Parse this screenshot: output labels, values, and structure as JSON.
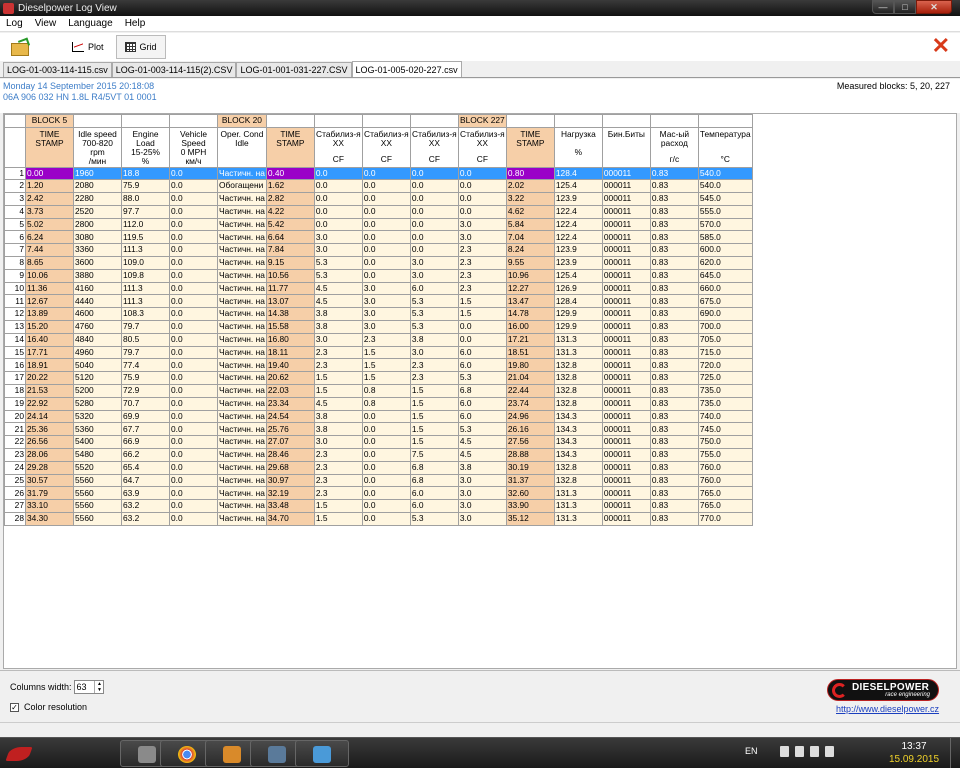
{
  "window": {
    "title": "Dieselpower Log View",
    "close": "✕",
    "max": "□",
    "min": "—"
  },
  "menu": [
    "Log",
    "View",
    "Language",
    "Help"
  ],
  "toolbar": {
    "plot_label": "Plot",
    "grid_label": "Grid"
  },
  "tabs": [
    "LOG-01-003-114-115.csv",
    "LOG-01-003-114-115(2).CSV",
    "LOG-01-001-031-227.CSV",
    "LOG-01-005-020-227.csv"
  ],
  "active_tab": 3,
  "info": {
    "date": "Monday 14 September 2015 20:18:08",
    "vehicle": "06A 906 032 HN   1.8L R4/5VT     01 0001",
    "measured_blocks": "Measured blocks: 5, 20, 227"
  },
  "blocks": [
    {
      "label": "BLOCK 5",
      "span": 4
    },
    {
      "label": "BLOCK 20",
      "span": 5
    },
    {
      "label": "BLOCK 227",
      "span": 5
    }
  ],
  "columns": [
    {
      "lines": [
        "TIME",
        "STAMP"
      ],
      "ts": true
    },
    {
      "lines": [
        "Idle speed",
        "700-820 rpm",
        "/мин"
      ]
    },
    {
      "lines": [
        "Engine Load",
        "15-25%",
        "%"
      ]
    },
    {
      "lines": [
        "Vehicle",
        "Speed",
        "0 MPH",
        "км/ч"
      ]
    },
    {
      "lines": [
        "Oper. Cond",
        "Idle"
      ]
    },
    {
      "lines": [
        "TIME",
        "STAMP"
      ],
      "ts": true
    },
    {
      "lines": [
        "Стабилиз-я",
        "XX"
      ],
      "unit": "CF"
    },
    {
      "lines": [
        "Стабилиз-я",
        "XX"
      ],
      "unit": "CF"
    },
    {
      "lines": [
        "Стабилиз-я",
        "XX"
      ],
      "unit": "CF"
    },
    {
      "lines": [
        "Стабилиз-я",
        "XX"
      ],
      "unit": "CF"
    },
    {
      "lines": [
        "TIME",
        "STAMP"
      ],
      "ts": true
    },
    {
      "lines": [
        "Нагрузка",
        "",
        "%"
      ]
    },
    {
      "lines": [
        "Бин.Биты"
      ]
    },
    {
      "lines": [
        "Мас-ый",
        "расход"
      ],
      "unit": "г/с"
    },
    {
      "lines": [
        "Температура"
      ],
      "unit": "°C"
    }
  ],
  "rows": [
    [
      "0.00",
      "1960",
      "18.8",
      "0.0",
      "Частичн. на",
      "0.40",
      "0.0",
      "0.0",
      "0.0",
      "0.0",
      "0.80",
      "128.4",
      "000011",
      "0.83",
      "540.0"
    ],
    [
      "1.20",
      "2080",
      "75.9",
      "0.0",
      "Обогащени",
      "1.62",
      "0.0",
      "0.0",
      "0.0",
      "0.0",
      "2.02",
      "125.4",
      "000011",
      "0.83",
      "540.0"
    ],
    [
      "2.42",
      "2280",
      "88.0",
      "0.0",
      "Частичн. на",
      "2.82",
      "0.0",
      "0.0",
      "0.0",
      "0.0",
      "3.22",
      "123.9",
      "000011",
      "0.83",
      "545.0"
    ],
    [
      "3.73",
      "2520",
      "97.7",
      "0.0",
      "Частичн. на",
      "4.22",
      "0.0",
      "0.0",
      "0.0",
      "0.0",
      "4.62",
      "122.4",
      "000011",
      "0.83",
      "555.0"
    ],
    [
      "5.02",
      "2800",
      "112.0",
      "0.0",
      "Частичн. на",
      "5.42",
      "0.0",
      "0.0",
      "0.0",
      "3.0",
      "5.84",
      "122.4",
      "000011",
      "0.83",
      "570.0"
    ],
    [
      "6.24",
      "3080",
      "119.5",
      "0.0",
      "Частичн. на",
      "6.64",
      "3.0",
      "0.0",
      "0.0",
      "3.0",
      "7.04",
      "122.4",
      "000011",
      "0.83",
      "585.0"
    ],
    [
      "7.44",
      "3360",
      "111.3",
      "0.0",
      "Частичн. на",
      "7.84",
      "3.0",
      "0.0",
      "0.0",
      "2.3",
      "8.24",
      "123.9",
      "000011",
      "0.83",
      "600.0"
    ],
    [
      "8.65",
      "3600",
      "109.0",
      "0.0",
      "Частичн. на",
      "9.15",
      "5.3",
      "0.0",
      "3.0",
      "2.3",
      "9.55",
      "123.9",
      "000011",
      "0.83",
      "620.0"
    ],
    [
      "10.06",
      "3880",
      "109.8",
      "0.0",
      "Частичн. на",
      "10.56",
      "5.3",
      "0.0",
      "3.0",
      "2.3",
      "10.96",
      "125.4",
      "000011",
      "0.83",
      "645.0"
    ],
    [
      "11.36",
      "4160",
      "111.3",
      "0.0",
      "Частичн. на",
      "11.77",
      "4.5",
      "3.0",
      "6.0",
      "2.3",
      "12.27",
      "126.9",
      "000011",
      "0.83",
      "660.0"
    ],
    [
      "12.67",
      "4440",
      "111.3",
      "0.0",
      "Частичн. на",
      "13.07",
      "4.5",
      "3.0",
      "5.3",
      "1.5",
      "13.47",
      "128.4",
      "000011",
      "0.83",
      "675.0"
    ],
    [
      "13.89",
      "4600",
      "108.3",
      "0.0",
      "Частичн. на",
      "14.38",
      "3.8",
      "3.0",
      "5.3",
      "1.5",
      "14.78",
      "129.9",
      "000011",
      "0.83",
      "690.0"
    ],
    [
      "15.20",
      "4760",
      "79.7",
      "0.0",
      "Частичн. на",
      "15.58",
      "3.8",
      "3.0",
      "5.3",
      "0.0",
      "16.00",
      "129.9",
      "000011",
      "0.83",
      "700.0"
    ],
    [
      "16.40",
      "4840",
      "80.5",
      "0.0",
      "Частичн. на",
      "16.80",
      "3.0",
      "2.3",
      "3.8",
      "0.0",
      "17.21",
      "131.3",
      "000011",
      "0.83",
      "705.0"
    ],
    [
      "17.71",
      "4960",
      "79.7",
      "0.0",
      "Частичн. на",
      "18.11",
      "2.3",
      "1.5",
      "3.0",
      "6.0",
      "18.51",
      "131.3",
      "000011",
      "0.83",
      "715.0"
    ],
    [
      "18.91",
      "5040",
      "77.4",
      "0.0",
      "Частичн. на",
      "19.40",
      "2.3",
      "1.5",
      "2.3",
      "6.0",
      "19.80",
      "132.8",
      "000011",
      "0.83",
      "720.0"
    ],
    [
      "20.22",
      "5120",
      "75.9",
      "0.0",
      "Частичн. на",
      "20.62",
      "1.5",
      "1.5",
      "2.3",
      "5.3",
      "21.04",
      "132.8",
      "000011",
      "0.83",
      "725.0"
    ],
    [
      "21.53",
      "5200",
      "72.9",
      "0.0",
      "Частичн. на",
      "22.03",
      "1.5",
      "0.8",
      "1.5",
      "6.8",
      "22.44",
      "132.8",
      "000011",
      "0.83",
      "735.0"
    ],
    [
      "22.92",
      "5280",
      "70.7",
      "0.0",
      "Частичн. на",
      "23.34",
      "4.5",
      "0.8",
      "1.5",
      "6.0",
      "23.74",
      "132.8",
      "000011",
      "0.83",
      "735.0"
    ],
    [
      "24.14",
      "5320",
      "69.9",
      "0.0",
      "Частичн. на",
      "24.54",
      "3.8",
      "0.0",
      "1.5",
      "6.0",
      "24.96",
      "134.3",
      "000011",
      "0.83",
      "740.0"
    ],
    [
      "25.36",
      "5360",
      "67.7",
      "0.0",
      "Частичн. на",
      "25.76",
      "3.8",
      "0.0",
      "1.5",
      "5.3",
      "26.16",
      "134.3",
      "000011",
      "0.83",
      "745.0"
    ],
    [
      "26.56",
      "5400",
      "66.9",
      "0.0",
      "Частичн. на",
      "27.07",
      "3.0",
      "0.0",
      "1.5",
      "4.5",
      "27.56",
      "134.3",
      "000011",
      "0.83",
      "750.0"
    ],
    [
      "28.06",
      "5480",
      "66.2",
      "0.0",
      "Частичн. на",
      "28.46",
      "2.3",
      "0.0",
      "7.5",
      "4.5",
      "28.88",
      "134.3",
      "000011",
      "0.83",
      "755.0"
    ],
    [
      "29.28",
      "5520",
      "65.4",
      "0.0",
      "Частичн. на",
      "29.68",
      "2.3",
      "0.0",
      "6.8",
      "3.8",
      "30.19",
      "132.8",
      "000011",
      "0.83",
      "760.0"
    ],
    [
      "30.57",
      "5560",
      "64.7",
      "0.0",
      "Частичн. на",
      "30.97",
      "2.3",
      "0.0",
      "6.8",
      "3.0",
      "31.37",
      "132.8",
      "000011",
      "0.83",
      "760.0"
    ],
    [
      "31.79",
      "5560",
      "63.9",
      "0.0",
      "Частичн. на",
      "32.19",
      "2.3",
      "0.0",
      "6.0",
      "3.0",
      "32.60",
      "131.3",
      "000011",
      "0.83",
      "765.0"
    ],
    [
      "33.10",
      "5560",
      "63.2",
      "0.0",
      "Частичн. на",
      "33.48",
      "1.5",
      "0.0",
      "6.0",
      "3.0",
      "33.90",
      "131.3",
      "000011",
      "0.83",
      "765.0"
    ],
    [
      "34.30",
      "5560",
      "63.2",
      "0.0",
      "Частичн. на",
      "34.70",
      "1.5",
      "0.0",
      "5.3",
      "3.0",
      "35.12",
      "131.3",
      "000011",
      "0.83",
      "770.0"
    ]
  ],
  "selected_row": 0,
  "bottom": {
    "columns_width_label": "Columns width:",
    "columns_width_value": "63",
    "color_resolution_label": "Color resolution",
    "color_resolution_checked": "✓",
    "logo_text": "DIESELPOWER",
    "logo_sub": "race engineering",
    "url": "http://www.dieselpower.cz"
  },
  "taskbar": {
    "lang": "EN",
    "time": "13:37",
    "date": "15.09.2015"
  }
}
